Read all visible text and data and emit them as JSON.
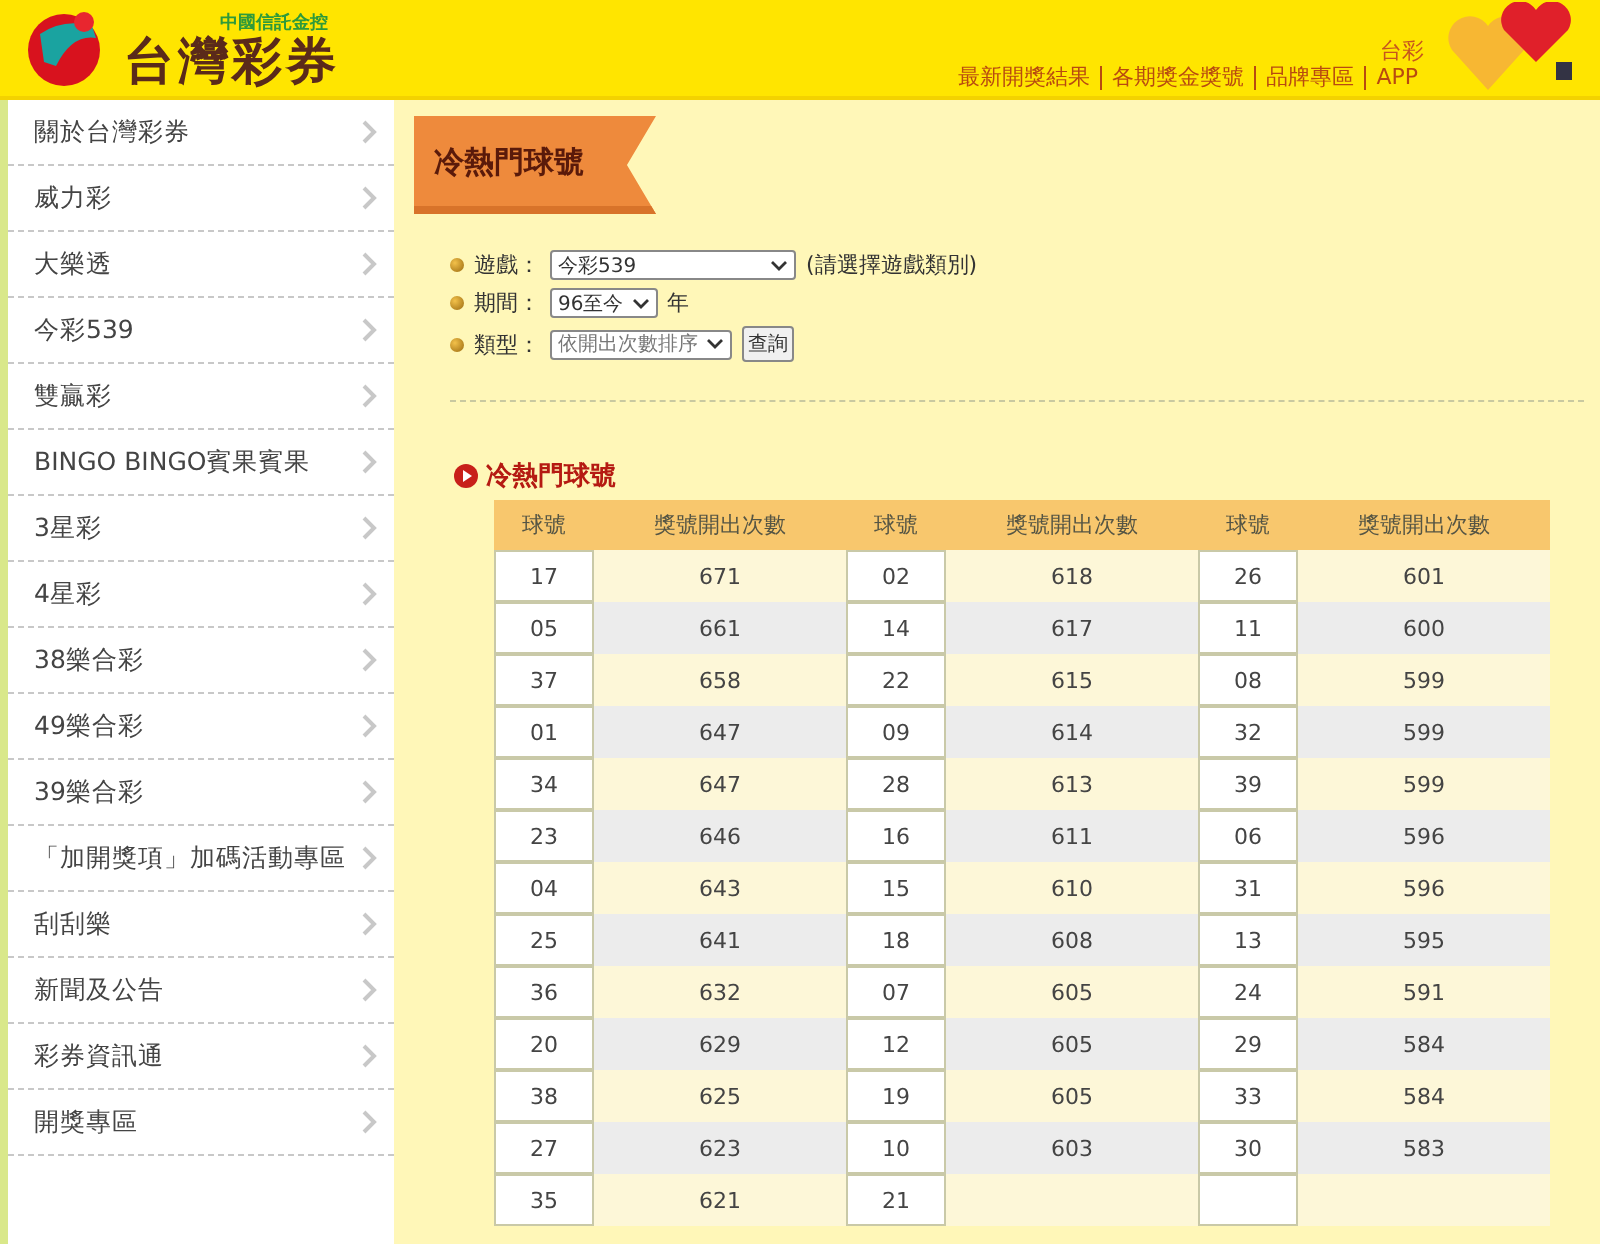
{
  "header": {
    "logo_subtitle": "中國信託金控",
    "logo_title": "台灣彩券",
    "links": [
      "最新開獎結果",
      "各期獎金獎號",
      "品牌專區",
      "APP"
    ],
    "app_label": "台彩"
  },
  "sidebar": {
    "items": [
      "關於台灣彩券",
      "威力彩",
      "大樂透",
      "今彩539",
      "雙贏彩",
      "BINGO BINGO賓果賓果",
      "3星彩",
      "4星彩",
      "38樂合彩",
      "49樂合彩",
      "39樂合彩",
      "「加開獎項」加碼活動專區",
      "刮刮樂",
      "新聞及公告",
      "彩券資訊通",
      "開獎專區"
    ]
  },
  "page_title": "冷熱門球號",
  "form": {
    "fields": [
      {
        "label": "遊戲：",
        "value": "今彩539",
        "note": "(請選擇遊戲類別)",
        "kind": "wide"
      },
      {
        "label": "期間：",
        "value": "96至今",
        "note": "年",
        "kind": "short"
      },
      {
        "label": "類型：",
        "value": "依開出次數排序",
        "button": "查詢",
        "kind": "medium"
      }
    ]
  },
  "section_title": "冷熱門球號",
  "table": {
    "columns": [
      "球號",
      "獎號開出次數",
      "球號",
      "獎號開出次數",
      "球號",
      "獎號開出次數"
    ],
    "rows": [
      [
        "17",
        "671",
        "02",
        "618",
        "26",
        "601"
      ],
      [
        "05",
        "661",
        "14",
        "617",
        "11",
        "600"
      ],
      [
        "37",
        "658",
        "22",
        "615",
        "08",
        "599"
      ],
      [
        "01",
        "647",
        "09",
        "614",
        "32",
        "599"
      ],
      [
        "34",
        "647",
        "28",
        "613",
        "39",
        "599"
      ],
      [
        "23",
        "646",
        "16",
        "611",
        "06",
        "596"
      ],
      [
        "04",
        "643",
        "15",
        "610",
        "31",
        "596"
      ],
      [
        "25",
        "641",
        "18",
        "608",
        "13",
        "595"
      ],
      [
        "36",
        "632",
        "07",
        "605",
        "24",
        "591"
      ],
      [
        "20",
        "629",
        "12",
        "605",
        "29",
        "584"
      ],
      [
        "38",
        "625",
        "19",
        "605",
        "33",
        "584"
      ],
      [
        "27",
        "623",
        "10",
        "603",
        "30",
        "583"
      ],
      [
        "35",
        "621",
        "21"
      ]
    ]
  }
}
